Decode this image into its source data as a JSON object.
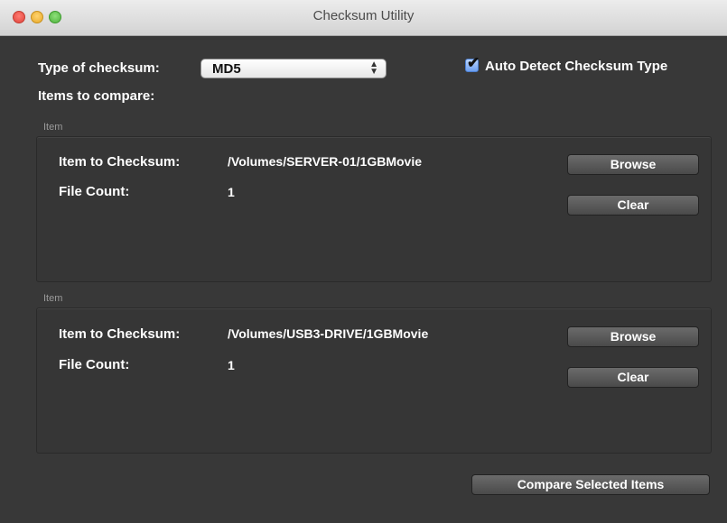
{
  "window": {
    "title": "Checksum Utility"
  },
  "controls": {
    "type_label": "Type of checksum:",
    "type_selected": "MD5",
    "auto_detect_label": "Auto Detect Checksum Type",
    "auto_detect_checked": true,
    "items_label": "Items to compare:"
  },
  "items": [
    {
      "group_label": "Item",
      "path_label": "Item to Checksum:",
      "path_value": "/Volumes/SERVER-01/1GBMovie",
      "count_label": "File Count:",
      "count_value": "1",
      "browse_label": "Browse",
      "clear_label": "Clear"
    },
    {
      "group_label": "Item",
      "path_label": "Item to Checksum:",
      "path_value": "/Volumes/USB3-DRIVE/1GBMovie",
      "count_label": "File Count:",
      "count_value": "1",
      "browse_label": "Browse",
      "clear_label": "Clear"
    }
  ],
  "footer": {
    "compare_label": "Compare Selected Items"
  }
}
